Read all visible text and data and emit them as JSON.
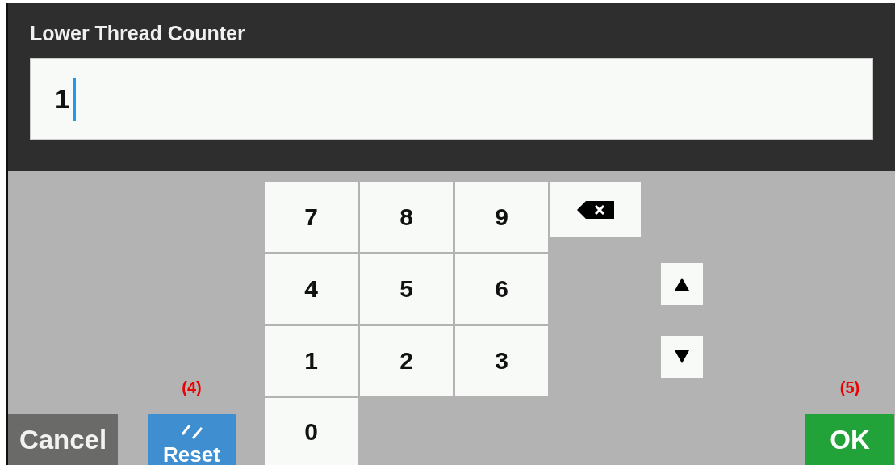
{
  "dialog": {
    "title": "Lower Thread Counter"
  },
  "field": {
    "value": "1"
  },
  "keys": [
    {
      "label": "7"
    },
    {
      "label": "8"
    },
    {
      "label": "9"
    },
    {
      "label": "4"
    },
    {
      "label": "5"
    },
    {
      "label": "6"
    },
    {
      "label": "1"
    },
    {
      "label": "2"
    },
    {
      "label": "3"
    },
    {
      "label": "0"
    }
  ],
  "buttons": {
    "cancel": {
      "label": "Cancel"
    },
    "reset": {
      "label": "Reset",
      "callout": "(4)"
    },
    "ok": {
      "label": "OK",
      "callout": "(5)"
    }
  }
}
